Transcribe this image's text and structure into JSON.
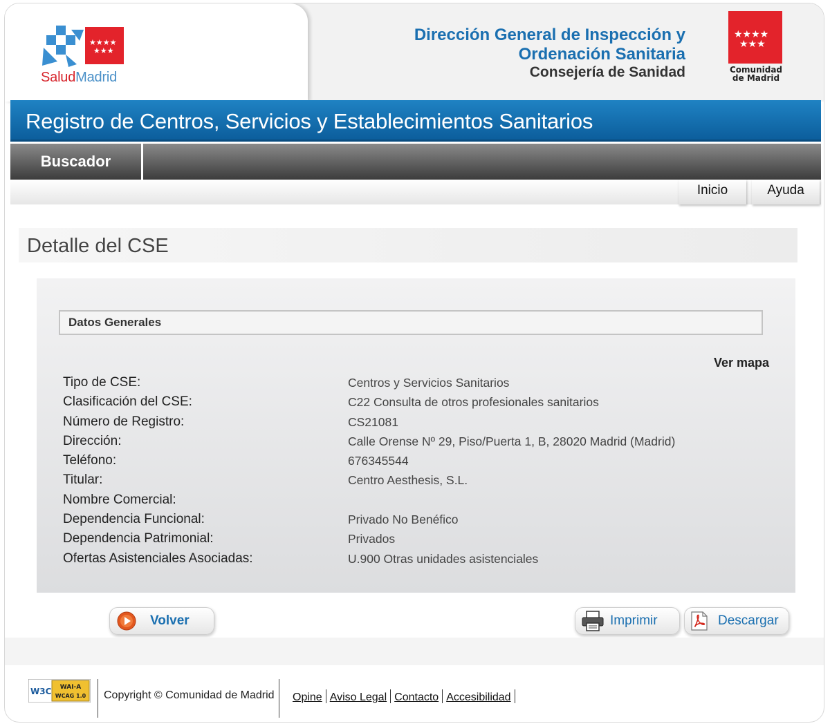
{
  "header": {
    "salud_logo_part1": "Salud",
    "salud_logo_part2": "Madrid",
    "department_line1": "Dirección General de Inspección y",
    "department_line2": "Ordenación Sanitaria",
    "ministry": "Consejería de Sanidad",
    "region_logo_line1": "Comunidad",
    "region_logo_line2": "de Madrid"
  },
  "banner": {
    "title": "Registro de Centros, Servicios y Establecimientos Sanitarios"
  },
  "nav": {
    "main_items": [
      {
        "label": "Buscador"
      }
    ],
    "sub_items": [
      {
        "label": "Inicio"
      },
      {
        "label": "Ayuda"
      }
    ]
  },
  "page": {
    "title": "Detalle del CSE"
  },
  "details": {
    "section_title": "Datos Generales",
    "map_link": "Ver mapa",
    "fields": [
      {
        "label": "Tipo de CSE:",
        "value": "Centros y Servicios Sanitarios"
      },
      {
        "label": "Clasificación del CSE:",
        "value": "C22 Consulta de otros profesionales sanitarios"
      },
      {
        "label": "Número de Registro:",
        "value": "CS21081"
      },
      {
        "label": "Dirección:",
        "value": "Calle Orense Nº 29, Piso/Puerta 1, B, 28020 Madrid (Madrid)"
      },
      {
        "label": "Teléfono:",
        "value": "676345544"
      },
      {
        "label": "Titular:",
        "value": "Centro Aesthesis, S.L."
      },
      {
        "label": "Nombre Comercial:",
        "value": ""
      },
      {
        "label": "Dependencia Funcional:",
        "value": "Privado No Benéfico"
      },
      {
        "label": "Dependencia Patrimonial:",
        "value": "Privados"
      },
      {
        "label": "Ofertas Asistenciales Asociadas:",
        "value": "U.900 Otras unidades asistenciales"
      }
    ]
  },
  "actions": {
    "back": "Volver",
    "print": "Imprimir",
    "download": "Descargar"
  },
  "footer": {
    "badge_w3c": "W3C",
    "badge_wai_line1": "WAI-A",
    "badge_wai_line2": "WCAG 1.0",
    "copyright": "Copyright © Comunidad de Madrid",
    "links": [
      "Opine",
      "Aviso Legal",
      "Contacto",
      "Accesibilidad"
    ]
  },
  "colors": {
    "brand_blue": "#1a6fb0",
    "madrid_red": "#e3232b",
    "nav_gray": "#3c3c3c"
  }
}
